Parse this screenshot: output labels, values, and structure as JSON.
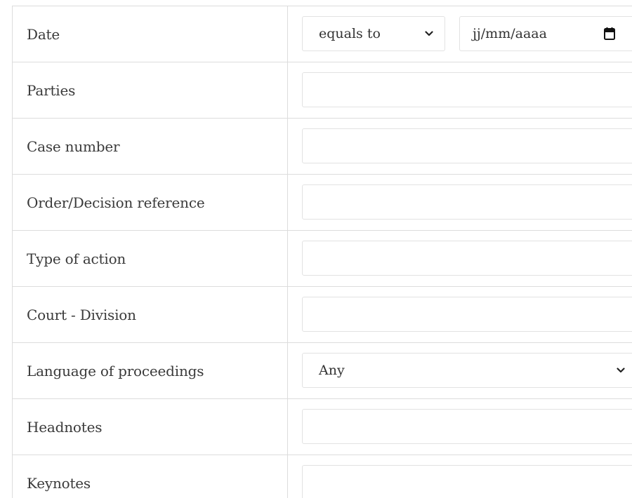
{
  "form": {
    "rows": [
      {
        "label": "Date",
        "operator": "equals to",
        "date_placeholder": "jj/mm/aaaa"
      },
      {
        "label": "Parties",
        "value": ""
      },
      {
        "label": "Case number",
        "value": ""
      },
      {
        "label": "Order/Decision reference",
        "value": ""
      },
      {
        "label": "Type of action",
        "value": ""
      },
      {
        "label": "Court - Division",
        "value": ""
      },
      {
        "label": "Language of proceedings",
        "selected": "Any"
      },
      {
        "label": "Headnotes",
        "value": ""
      },
      {
        "label": "Keynotes",
        "value": ""
      }
    ]
  },
  "icons": {
    "operator_chevron": "chevron-down-icon",
    "language_chevron": "chevron-down-icon",
    "date_picker": "calendar-icon"
  },
  "colors": {
    "border": "#dcdcdc",
    "input_border": "#e2e2e2",
    "text": "#3a3a3a"
  }
}
